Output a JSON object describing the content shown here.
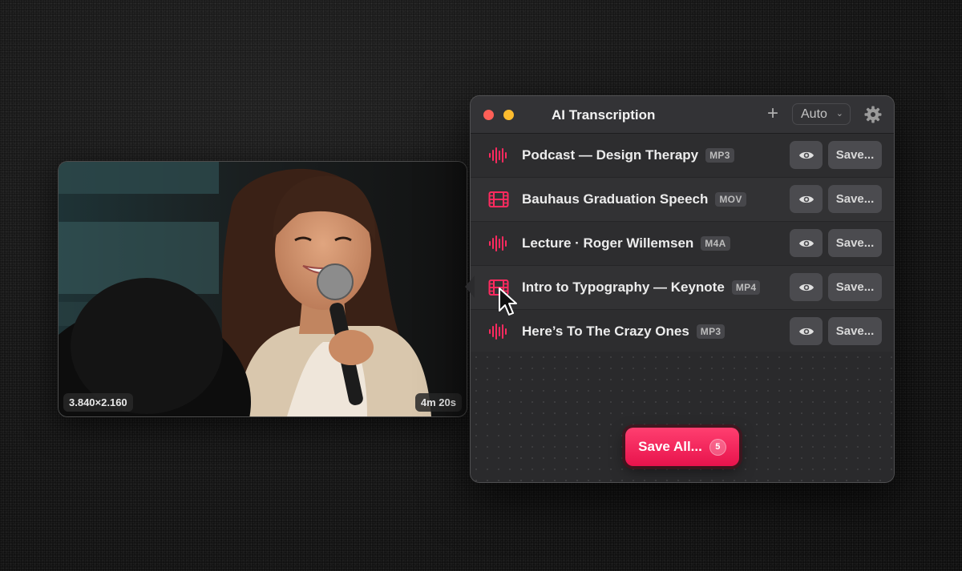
{
  "preview": {
    "resolution": "3.840×2.160",
    "duration": "4m 20s"
  },
  "window": {
    "title": "AI Transcription",
    "add_icon": "+",
    "language_select": {
      "value": "Auto",
      "chevron": "⌄"
    }
  },
  "items": [
    {
      "name": "Podcast — Design Therapy",
      "format": "MP3",
      "type": "audio",
      "save_label": "Save..."
    },
    {
      "name": "Bauhaus Graduation Speech",
      "format": "MOV",
      "type": "video",
      "save_label": "Save..."
    },
    {
      "name": "Lecture · Roger Willemsen",
      "format": "M4A",
      "type": "audio",
      "save_label": "Save..."
    },
    {
      "name": "Intro to Typography — Keynote",
      "format": "MP4",
      "type": "video",
      "save_label": "Save..."
    },
    {
      "name": "Here’s To The Crazy Ones",
      "format": "MP3",
      "type": "audio",
      "save_label": "Save..."
    }
  ],
  "save_all": {
    "label": "Save All...",
    "count": "5"
  },
  "colors": {
    "accent": "#ff2a5f",
    "window_bg": "#2a2a2c"
  }
}
